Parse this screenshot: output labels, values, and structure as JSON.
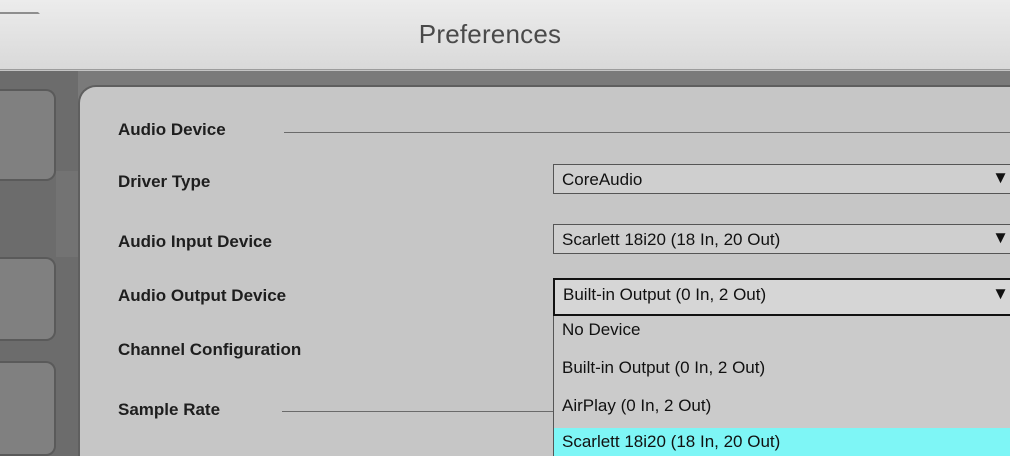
{
  "window": {
    "title": "Preferences"
  },
  "section": {
    "audio_device": "Audio Device",
    "sample_rate": "Sample Rate"
  },
  "fields": {
    "driver_type": {
      "label": "Driver Type",
      "value": "CoreAudio"
    },
    "input_device": {
      "label": "Audio Input Device",
      "value": "Scarlett 18i20 (18 In, 20 Out)"
    },
    "output_device": {
      "label": "Audio Output Device",
      "value": "Built-in Output (0 In, 2 Out)"
    },
    "channel_config": {
      "label": "Channel Configuration"
    }
  },
  "dropdown_arrow": "▼",
  "dropdown": {
    "options": [
      "No Device",
      "Built-in Output (0 In, 2 Out)",
      "AirPlay (0 In, 2 Out)",
      "Scarlett 18i20 (18 In, 20 Out)"
    ],
    "highlighted_index": 3
  },
  "colors": {
    "highlight": "#7ef6f6",
    "panel": "#c6c6c6",
    "frame": "#7a7a7a"
  }
}
